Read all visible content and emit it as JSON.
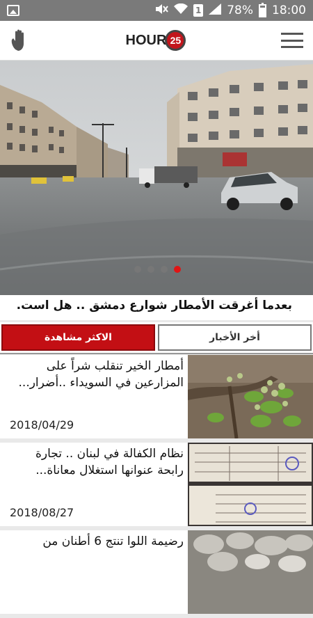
{
  "status_bar": {
    "battery": "78%",
    "time": "18:00",
    "sim_slot": "1",
    "battery_level": 0.78
  },
  "app_bar": {
    "logo_text": "HOUR",
    "logo_number": "25"
  },
  "hero": {
    "headline": "بعدما أغرقت الأمطار شوارع دمشق .. هل است.",
    "slide_count": 4,
    "active_slide": 4
  },
  "tabs": [
    {
      "label": "أخر الأخبار",
      "active": false
    },
    {
      "label": "الاكثر مشاهدة",
      "active": true
    }
  ],
  "news": [
    {
      "title": "أمطار الخير تنقلب شراً على المزارعين في السويداء ..أضرار...",
      "date": "2018/04/29",
      "thumb": "pear-tree-branch"
    },
    {
      "title": "نظام الكفالة في لبنان .. تجارة رابحة عنوانها استغلال معاناة...",
      "date": "2018/08/27",
      "thumb": "official-documents"
    },
    {
      "title": "رضيمة اللوا تنتج 6 أطنان من",
      "date": "",
      "thumb": "stone-pile"
    }
  ],
  "colors": {
    "accent": "#c30f14",
    "status_bar": "#7a7a7a"
  }
}
